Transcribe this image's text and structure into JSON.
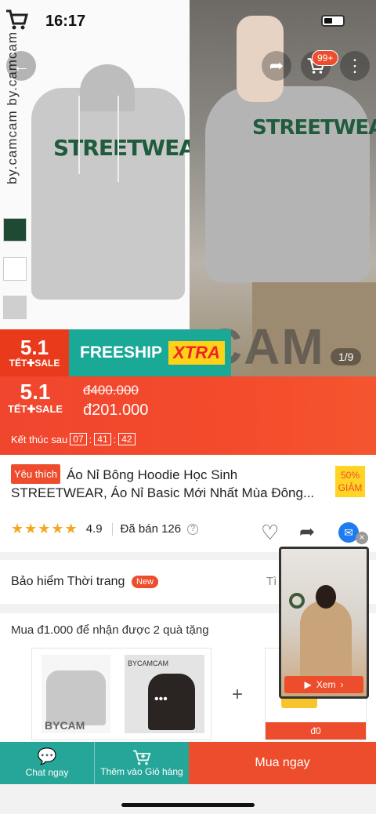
{
  "status": {
    "time": "16:17"
  },
  "hero": {
    "brand_vertical": "by.camcam by.camcam",
    "print_text": "STREETWEAR",
    "cart_badge": "99+",
    "watermark": "BYCAM",
    "image_counter": "1/9"
  },
  "promo": {
    "event_big": "5.1",
    "event_small": "TẾT✚SALE",
    "freeship": "FREESHIP",
    "xtra": "XTRA"
  },
  "price": {
    "event_big": "5.1",
    "event_small": "TẾT✚SALE",
    "old_price": "đ400.000",
    "new_price": "đ201.000",
    "ends_label": "Kết thúc sau",
    "countdown": {
      "h": "07",
      "m": "41",
      "s": "42"
    }
  },
  "product": {
    "fav_tag": "Yêu thích",
    "title": "Áo Nỉ Bông Hoodie Học Sinh STREETWEAR,  Áo Nỉ Basic Mới Nhất Mùa Đông...",
    "discount_pct": "50%",
    "discount_label": "GIẢM",
    "stars": "★★★★★",
    "rating": "4.9",
    "sold": "Đã bán 126",
    "stars_value": 4.9
  },
  "insurance": {
    "label": "Bảo hiểm Thời trang",
    "badge": "New",
    "more": "Tì"
  },
  "gift": {
    "title": "Mua đ1.000 để nhận được 2 quà tặng",
    "thumb1_text": "BYCAM",
    "thumb2_text": "BYCAMCAM",
    "gift_price": "đ0"
  },
  "video": {
    "button": "Xem"
  },
  "bottom": {
    "chat": "Chat ngay",
    "add_cart": "Thêm vào Giỏ hàng",
    "buy": "Mua ngay"
  },
  "colors": {
    "accent": "#ee4d2d",
    "teal": "#26a698"
  }
}
